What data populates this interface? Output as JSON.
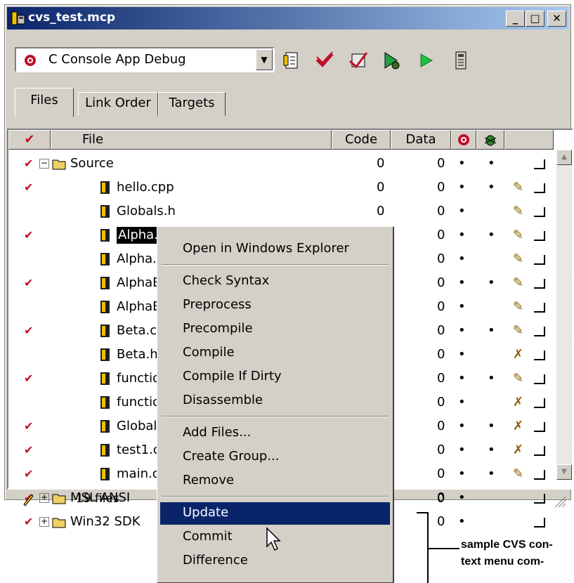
{
  "window": {
    "title": "cvs_test.mcp",
    "btn_min": "_",
    "btn_max": "□",
    "btn_close": "✕"
  },
  "toolbar": {
    "target": "C Console App Debug",
    "dropdown_arrow": "▼",
    "icons": [
      "project-settings-icon",
      "check-icon",
      "compile-icon",
      "debug-icon",
      "run-icon",
      "inspector-icon"
    ]
  },
  "tabs": [
    "Files",
    "Link Order",
    "Targets"
  ],
  "columns": {
    "check": "✔",
    "file": "File",
    "code": "Code",
    "data": "Data"
  },
  "rows": [
    {
      "check": true,
      "indent": 0,
      "expander": "−",
      "type": "folder",
      "name": "Source",
      "code": "0",
      "data": "0",
      "dot1": "•",
      "dot2": "•",
      "pencil": "",
      "selected": false
    },
    {
      "check": true,
      "indent": 1,
      "expander": "",
      "type": "file",
      "name": "hello.cpp",
      "code": "0",
      "data": "0",
      "dot1": "•",
      "dot2": "•",
      "pencil": "✎",
      "selected": false
    },
    {
      "check": false,
      "indent": 1,
      "expander": "",
      "type": "file",
      "name": "Globals.h",
      "code": "0",
      "data": "0",
      "dot1": "•",
      "dot2": "",
      "pencil": "✎",
      "selected": false
    },
    {
      "check": true,
      "indent": 1,
      "expander": "",
      "type": "file",
      "name": "Alpha.cp",
      "code": "0",
      "data": "0",
      "dot1": "•",
      "dot2": "•",
      "pencil": "✎",
      "selected": true
    },
    {
      "check": false,
      "indent": 1,
      "expander": "",
      "type": "file",
      "name": "Alpha.h",
      "code": "",
      "data": "0",
      "dot1": "•",
      "dot2": "",
      "pencil": "✎",
      "selected": false
    },
    {
      "check": true,
      "indent": 1,
      "expander": "",
      "type": "file",
      "name": "AlphaBe",
      "code": "",
      "data": "0",
      "dot1": "•",
      "dot2": "•",
      "pencil": "✎",
      "selected": false
    },
    {
      "check": false,
      "indent": 1,
      "expander": "",
      "type": "file",
      "name": "AlphaBe",
      "code": "",
      "data": "0",
      "dot1": "•",
      "dot2": "",
      "pencil": "✎",
      "selected": false
    },
    {
      "check": true,
      "indent": 1,
      "expander": "",
      "type": "file",
      "name": "Beta.cp",
      "code": "",
      "data": "0",
      "dot1": "•",
      "dot2": "•",
      "pencil": "✎",
      "selected": false
    },
    {
      "check": false,
      "indent": 1,
      "expander": "",
      "type": "file",
      "name": "Beta.h",
      "code": "",
      "data": "0",
      "dot1": "•",
      "dot2": "",
      "pencil": "✗",
      "selected": false
    },
    {
      "check": true,
      "indent": 1,
      "expander": "",
      "type": "file",
      "name": "functior",
      "code": "",
      "data": "0",
      "dot1": "•",
      "dot2": "•",
      "pencil": "✎",
      "selected": false
    },
    {
      "check": false,
      "indent": 1,
      "expander": "",
      "type": "file",
      "name": "function",
      "code": "",
      "data": "0",
      "dot1": "•",
      "dot2": "",
      "pencil": "✗",
      "selected": false
    },
    {
      "check": true,
      "indent": 1,
      "expander": "",
      "type": "file",
      "name": "Globals.",
      "code": "",
      "data": "0",
      "dot1": "•",
      "dot2": "•",
      "pencil": "✗",
      "selected": false
    },
    {
      "check": true,
      "indent": 1,
      "expander": "",
      "type": "file",
      "name": "test1.cp",
      "code": "",
      "data": "0",
      "dot1": "•",
      "dot2": "•",
      "pencil": "✗",
      "selected": false
    },
    {
      "check": true,
      "indent": 1,
      "expander": "",
      "type": "file",
      "name": "main.c",
      "code": "",
      "data": "0",
      "dot1": "•",
      "dot2": "•",
      "pencil": "✎",
      "selected": false
    },
    {
      "check": true,
      "indent": 0,
      "expander": "+",
      "type": "folder",
      "name": "MSL ANSI",
      "code": "",
      "data": "0",
      "dot1": "•",
      "dot2": "",
      "pencil": "",
      "selected": false
    },
    {
      "check": true,
      "indent": 0,
      "expander": "+",
      "type": "folder",
      "name": "Win32 SDK",
      "code": "",
      "data": "0",
      "dot1": "•",
      "dot2": "",
      "pencil": "",
      "selected": false
    }
  ],
  "status": {
    "count": "19 files",
    "total": "0"
  },
  "menu": {
    "items": [
      {
        "label": "Open in Windows Explorer",
        "sep_after": true,
        "highlight": false
      },
      {
        "label": "Check Syntax",
        "sep_after": false,
        "highlight": false
      },
      {
        "label": "Preprocess",
        "sep_after": false,
        "highlight": false
      },
      {
        "label": "Precompile",
        "sep_after": false,
        "highlight": false
      },
      {
        "label": "Compile",
        "sep_after": false,
        "highlight": false
      },
      {
        "label": "Compile If Dirty",
        "sep_after": false,
        "highlight": false
      },
      {
        "label": "Disassemble",
        "sep_after": true,
        "highlight": false
      },
      {
        "label": "Add Files...",
        "sep_after": false,
        "highlight": false
      },
      {
        "label": "Create Group...",
        "sep_after": false,
        "highlight": false
      },
      {
        "label": "Remove",
        "sep_after": true,
        "highlight": false
      },
      {
        "label": "Update",
        "sep_after": false,
        "highlight": true
      },
      {
        "label": "Commit",
        "sep_after": false,
        "highlight": false
      },
      {
        "label": "Difference",
        "sep_after": false,
        "highlight": false
      }
    ]
  },
  "caption": {
    "line1": "sample CVS con-",
    "line2": "text menu com-"
  },
  "colors": {
    "titlebar": "#0a246a",
    "highlight": "#0a246a",
    "check": "#c0102a",
    "face": "#d4d0c8"
  }
}
